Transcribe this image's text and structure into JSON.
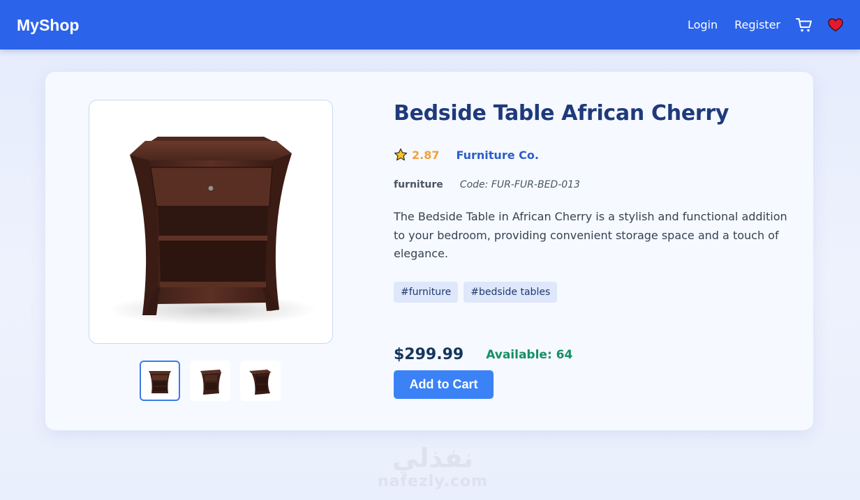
{
  "header": {
    "brand": "MyShop",
    "login_label": "Login",
    "register_label": "Register",
    "cart_icon": "cart-icon",
    "wishlist_icon": "heart-icon",
    "bar_color": "#2b63ea"
  },
  "product": {
    "title": "Bedside Table African Cherry",
    "rating": "2.87",
    "rating_icon": "star-icon",
    "brand": "Furniture Co.",
    "category": "furniture",
    "code": "Code: FUR-FUR-BED-013",
    "description": "The Bedside Table in African Cherry is a stylish and functional addition to your bedroom, providing convenient storage space and a touch of elegance.",
    "tags": [
      "#furniture",
      "#bedside tables"
    ],
    "price": "$299.99",
    "availability": "Available: 64",
    "add_to_cart_label": "Add to Cart",
    "thumbnails": [
      "thumbnail-front",
      "thumbnail-angle-left",
      "thumbnail-angle-right"
    ],
    "active_thumbnail": 0
  },
  "colors": {
    "accent": "#3b82f6",
    "title": "#1e3a7b",
    "rating": "#f0a13b",
    "available": "#149064",
    "price": "#14365e"
  },
  "watermark": {
    "arabic": "نفذلي",
    "latin": "nafezly.com"
  }
}
